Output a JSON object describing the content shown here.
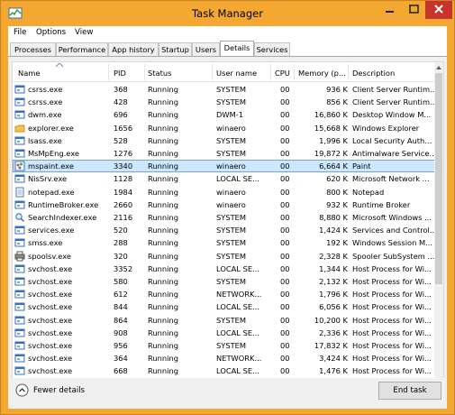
{
  "window": {
    "title": "Task Manager"
  },
  "menu": [
    "File",
    "Options",
    "View"
  ],
  "tabs": [
    "Processes",
    "Performance",
    "App history",
    "Startup",
    "Users",
    "Details",
    "Services"
  ],
  "active_tab": "Details",
  "columns": [
    "Name",
    "PID",
    "Status",
    "User name",
    "CPU",
    "Memory (p...",
    "Description"
  ],
  "sort_column": "Name",
  "rows": [
    {
      "name": "csrss.exe",
      "pid": "368",
      "status": "Running",
      "user": "SYSTEM",
      "cpu": "00",
      "memory": "936 K",
      "description": "Client Server Runtim...",
      "icon": "system-process-icon"
    },
    {
      "name": "csrss.exe",
      "pid": "428",
      "status": "Running",
      "user": "SYSTEM",
      "cpu": "00",
      "memory": "856 K",
      "description": "Client Server Runtim...",
      "icon": "system-process-icon"
    },
    {
      "name": "dwm.exe",
      "pid": "696",
      "status": "Running",
      "user": "DWM-1",
      "cpu": "00",
      "memory": "16,860 K",
      "description": "Desktop Window M...",
      "icon": "system-process-icon"
    },
    {
      "name": "explorer.exe",
      "pid": "1656",
      "status": "Running",
      "user": "winaero",
      "cpu": "00",
      "memory": "15,668 K",
      "description": "Windows Explorer",
      "icon": "explorer-folder-icon"
    },
    {
      "name": "lsass.exe",
      "pid": "528",
      "status": "Running",
      "user": "SYSTEM",
      "cpu": "00",
      "memory": "1,996 K",
      "description": "Local Security Auth...",
      "icon": "system-process-icon"
    },
    {
      "name": "MsMpEng.exe",
      "pid": "1276",
      "status": "Running",
      "user": "SYSTEM",
      "cpu": "00",
      "memory": "19,872 K",
      "description": "Antimalware Service...",
      "icon": "system-process-icon"
    },
    {
      "name": "mspaint.exe",
      "pid": "3340",
      "status": "Running",
      "user": "winaero",
      "cpu": "00",
      "memory": "6,664 K",
      "description": "Paint",
      "icon": "paint-icon",
      "selected": true
    },
    {
      "name": "NisSrv.exe",
      "pid": "1128",
      "status": "Running",
      "user": "LOCAL SE...",
      "cpu": "00",
      "memory": "620 K",
      "description": "Microsoft Network ...",
      "icon": "system-process-icon"
    },
    {
      "name": "notepad.exe",
      "pid": "1984",
      "status": "Running",
      "user": "winaero",
      "cpu": "00",
      "memory": "800 K",
      "description": "Notepad",
      "icon": "notepad-icon"
    },
    {
      "name": "RuntimeBroker.exe",
      "pid": "2660",
      "status": "Running",
      "user": "winaero",
      "cpu": "00",
      "memory": "932 K",
      "description": "Runtime Broker",
      "icon": "system-process-icon"
    },
    {
      "name": "SearchIndexer.exe",
      "pid": "2116",
      "status": "Running",
      "user": "SYSTEM",
      "cpu": "00",
      "memory": "8,880 K",
      "description": "Microsoft Windows ...",
      "icon": "search-indexer-icon"
    },
    {
      "name": "services.exe",
      "pid": "520",
      "status": "Running",
      "user": "SYSTEM",
      "cpu": "00",
      "memory": "1,424 K",
      "description": "Services and Control...",
      "icon": "system-process-icon"
    },
    {
      "name": "smss.exe",
      "pid": "288",
      "status": "Running",
      "user": "SYSTEM",
      "cpu": "00",
      "memory": "192 K",
      "description": "Windows Session M...",
      "icon": "system-process-icon"
    },
    {
      "name": "spoolsv.exe",
      "pid": "320",
      "status": "Running",
      "user": "SYSTEM",
      "cpu": "00",
      "memory": "2,328 K",
      "description": "Spooler SubSystem ...",
      "icon": "printer-icon"
    },
    {
      "name": "svchost.exe",
      "pid": "3352",
      "status": "Running",
      "user": "LOCAL SE...",
      "cpu": "00",
      "memory": "1,344 K",
      "description": "Host Process for Wi...",
      "icon": "system-process-icon"
    },
    {
      "name": "svchost.exe",
      "pid": "580",
      "status": "Running",
      "user": "SYSTEM",
      "cpu": "00",
      "memory": "2,132 K",
      "description": "Host Process for Wi...",
      "icon": "system-process-icon"
    },
    {
      "name": "svchost.exe",
      "pid": "612",
      "status": "Running",
      "user": "NETWORK...",
      "cpu": "00",
      "memory": "1,796 K",
      "description": "Host Process for Wi...",
      "icon": "system-process-icon"
    },
    {
      "name": "svchost.exe",
      "pid": "844",
      "status": "Running",
      "user": "LOCAL SE...",
      "cpu": "00",
      "memory": "6,056 K",
      "description": "Host Process for Wi...",
      "icon": "system-process-icon"
    },
    {
      "name": "svchost.exe",
      "pid": "864",
      "status": "Running",
      "user": "SYSTEM",
      "cpu": "00",
      "memory": "10,200 K",
      "description": "Host Process for Wi...",
      "icon": "system-process-icon"
    },
    {
      "name": "svchost.exe",
      "pid": "908",
      "status": "Running",
      "user": "LOCAL SE...",
      "cpu": "00",
      "memory": "2,336 K",
      "description": "Host Process for Wi...",
      "icon": "system-process-icon"
    },
    {
      "name": "svchost.exe",
      "pid": "956",
      "status": "Running",
      "user": "SYSTEM",
      "cpu": "00",
      "memory": "17,832 K",
      "description": "Host Process for Wi...",
      "icon": "system-process-icon"
    },
    {
      "name": "svchost.exe",
      "pid": "364",
      "status": "Running",
      "user": "NETWORK...",
      "cpu": "00",
      "memory": "3,424 K",
      "description": "Host Process for Wi...",
      "icon": "system-process-icon"
    },
    {
      "name": "svchost.exe",
      "pid": "668",
      "status": "Running",
      "user": "LOCAL SE...",
      "cpu": "00",
      "memory": "1,476 K",
      "description": "Host Process for Wi...",
      "icon": "system-process-icon"
    }
  ],
  "footer": {
    "fewer_details": "Fewer details",
    "end_task": "End task"
  },
  "colors": {
    "frame": "#f4a832",
    "close": "#c7342c",
    "selection": "#cce8ff",
    "selection_border": "#7da2ce"
  }
}
